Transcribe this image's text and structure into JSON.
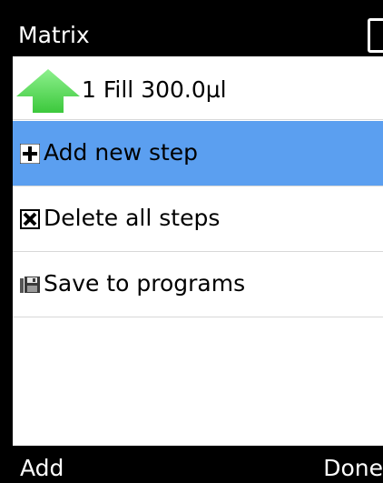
{
  "window": {
    "title": "Matrix"
  },
  "program": {
    "steps": [
      {
        "label": "1  Fill 300.0µl",
        "icon": "green-up-arrow-icon"
      }
    ]
  },
  "menu": {
    "items": [
      {
        "label": "Add new step",
        "icon": "plus-icon",
        "selected": true
      },
      {
        "label": "Delete all steps",
        "icon": "delete-x-icon",
        "selected": false
      },
      {
        "label": "Save to programs",
        "icon": "save-disk-icon",
        "selected": false
      }
    ]
  },
  "softkeys": {
    "left": "Add",
    "right": "Done"
  },
  "colors": {
    "selection": "#5b9ff0",
    "arrow": "#4cd94c",
    "bar": "#000000"
  }
}
